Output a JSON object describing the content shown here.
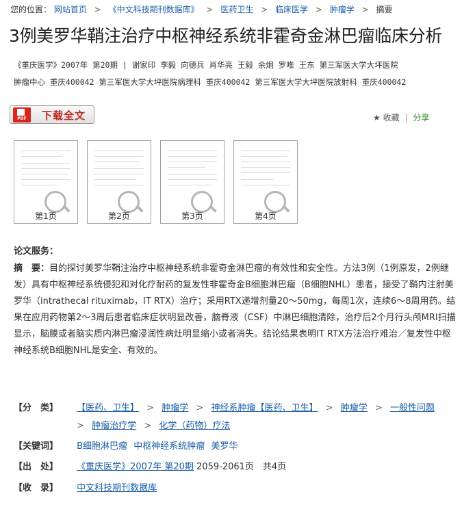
{
  "breadcrumb": {
    "prefix": "您的位置：",
    "items": [
      "网站首页",
      "《中文科技期刊数据库》",
      "医药卫生",
      "临床医学",
      "肿瘤学"
    ],
    "current": "摘要"
  },
  "article": {
    "title": "3例美罗华鞘注治疗中枢神经系统非霍奇金淋巴瘤临床分析",
    "meta_line1": "《重庆医学》2007年 第20期 | 谢家印 李毅 向德兵 肖华亮 王毅 余炯 罗唯 王东   第三军医大学大坪医院",
    "meta_line2": "肿瘤中心 重庆400042 第三军医大学大坪医院病理科 重庆400042 第三军医大学大坪医院放射科 重庆400042"
  },
  "actions": {
    "download_label": "下载全文",
    "pdf_icon_text": "PDF",
    "collect": "收藏",
    "share": "分享"
  },
  "pages": [
    "第1页",
    "第2页",
    "第3页",
    "第4页"
  ],
  "service": {
    "heading": "论文服务："
  },
  "abstract": {
    "label": "摘　要：",
    "text": "目的探讨美罗华鞘注治疗中枢神经系统非霍奇金淋巴瘤的有效性和安全性。方法3例（1例原发，2例继发）具有中枢神经系统侵犯和对化疗耐药的复发性非霍奇金B细胞淋巴瘤（B细胞NHL）患者，接受了鞘内注射美罗华（intrathecal rituximab，IT RTX）治疗；采用RTX递增剂量20～50mg，每周1次，连续6～8周用药。结果在应用药物第2～3周后患者临床症状明显改善，脑脊液（CSF）中淋巴细胞清除，治疗后2个月行头颅MRI扫描显示，脑膜或者脑实质内淋巴瘤浸润性病灶明显缩小或者消失。结论结果表明IT RTX方法治疗难治／复发性中枢神经系统B细胞NHL是安全、有效的。"
  },
  "classification": {
    "label": "【分　类】",
    "line1": [
      "【医药、卫生】",
      "肿瘤学",
      "神经系肿瘤【医药、卫生】",
      "肿瘤学",
      "一般性问题"
    ],
    "line2": [
      "肿瘤治疗学",
      "化学（药物）疗法"
    ]
  },
  "keywords": {
    "label": "【关键词】",
    "items": [
      "B细胞淋巴瘤",
      "中枢神经系统肿瘤",
      "美罗华"
    ]
  },
  "source": {
    "label": "【出　处】",
    "journal": "《重庆医学》2007年 第20期",
    "pages_text": "2059-2061页　共4页"
  },
  "indexed": {
    "label": "【收　录】",
    "db": "中文科技期刊数据库"
  }
}
